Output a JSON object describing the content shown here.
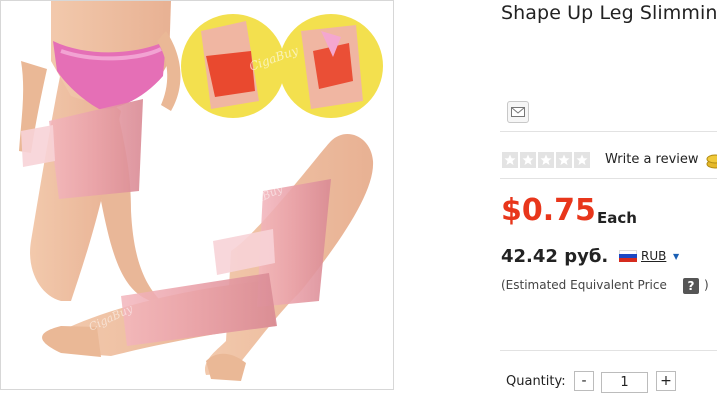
{
  "product": {
    "title": "Shape Up Leg Slimming",
    "image_alt": "product-photo",
    "watermark": "CigaBuy"
  },
  "actions": {
    "email_icon": "envelope-icon"
  },
  "rating": {
    "stars_filled": 0,
    "stars_total": 5,
    "write_review_label": "Write a review",
    "coin_icon": "coins-icon"
  },
  "pricing": {
    "price": "$0.75",
    "unit": "Each",
    "converted_price": "42.42 руб.",
    "currency_code": "RUB",
    "estimate_note": "(Estimated Equivalent Price",
    "help_label": "?",
    "estimate_close": ")"
  },
  "quantity": {
    "label": "Quantity:",
    "minus": "-",
    "value": "1",
    "plus": "+"
  },
  "colors": {
    "price": "#e8361b",
    "wrap": "#e3a0a6",
    "brief": "#e56fb6",
    "inset_bg": "#f3e04e"
  }
}
